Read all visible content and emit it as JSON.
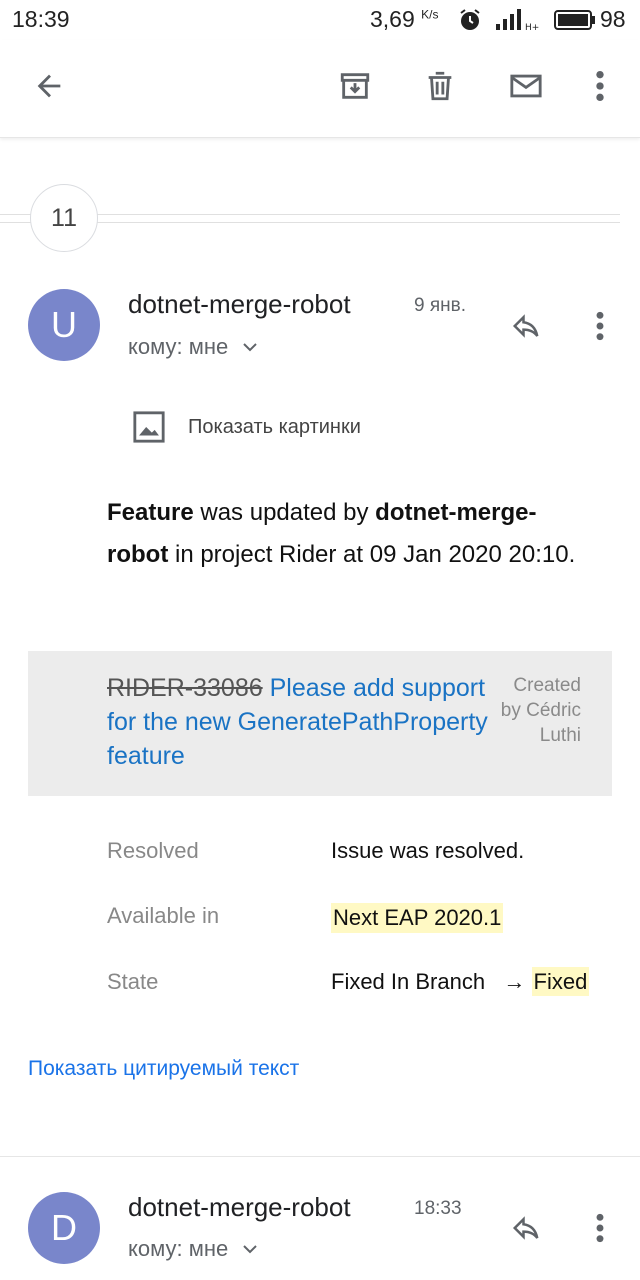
{
  "status_bar": {
    "time": "18:39",
    "net_speed": "3,69",
    "net_speed_unit": "K/s",
    "battery": "98",
    "icons": [
      "alarm-icon",
      "signal-icon",
      "battery-icon"
    ]
  },
  "toolbar": {
    "icons": [
      "back-arrow-icon",
      "archive-icon",
      "delete-icon",
      "mark-unread-icon",
      "more-vert-icon"
    ]
  },
  "thread": {
    "collapsed_count": "11"
  },
  "messages": [
    {
      "avatar_letter": "U",
      "sender": "dotnet-merge-robot",
      "date": "9 янв.",
      "recipient": "кому: мне",
      "show_images": "Показать картинки",
      "body": {
        "part1_bold": "Feature",
        "part2": " was updated by ",
        "part3_bold": "dotnet-merge-robot",
        "part4": " in project Rider at 09 Jan 2020 20:10."
      },
      "issue": {
        "id": "RIDER-33086",
        "title": "Please add support for the new GeneratePathProperty feature",
        "created_by": "Created by Cédric Luthi"
      },
      "fields": [
        {
          "label": "Resolved",
          "value": "Issue was resolved."
        },
        {
          "label": "Available in",
          "value": "Next EAP 2020.1"
        },
        {
          "label": "State",
          "value_old": "Fixed In Branch",
          "arrow": "→",
          "value_new": "Fixed"
        }
      ],
      "show_quoted": "Показать цитируемый текст"
    },
    {
      "avatar_letter": "D",
      "sender": "dotnet-merge-robot",
      "date": "18:33",
      "recipient": "кому: мне"
    }
  ],
  "colors": {
    "avatar": "#7986cb",
    "link": "#1a73e8",
    "highlight": "#fff9c4",
    "issue_bg": "#ececec"
  }
}
